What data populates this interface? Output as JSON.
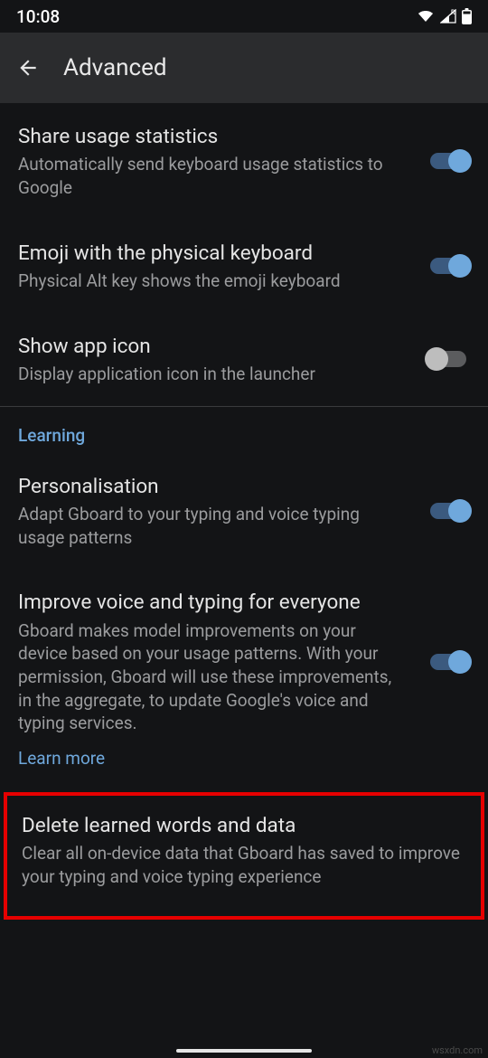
{
  "status": {
    "time": "10:08"
  },
  "appbar": {
    "title": "Advanced"
  },
  "settings": {
    "share_usage": {
      "title": "Share usage statistics",
      "desc": "Automatically send keyboard usage statistics to Google"
    },
    "emoji_physical": {
      "title": "Emoji with the physical keyboard",
      "desc": "Physical Alt key shows the emoji keyboard"
    },
    "show_app_icon": {
      "title": "Show app icon",
      "desc": "Display application icon in the launcher"
    },
    "personalisation": {
      "title": "Personalisation",
      "desc": "Adapt Gboard to your typing and voice typing usage patterns"
    },
    "improve_voice": {
      "title": "Improve voice and typing for everyone",
      "desc": "Gboard makes model improvements on your device based on your usage patterns. With your permission, Gboard will use these improvements, in the aggregate, to update Google's voice and typing services."
    },
    "delete_learned": {
      "title": "Delete learned words and data",
      "desc": "Clear all on-device data that Gboard has saved to improve your typing and voice typing experience"
    }
  },
  "section": {
    "learning": "Learning"
  },
  "links": {
    "learn_more": "Learn more"
  },
  "watermark": "wsxdn.com"
}
